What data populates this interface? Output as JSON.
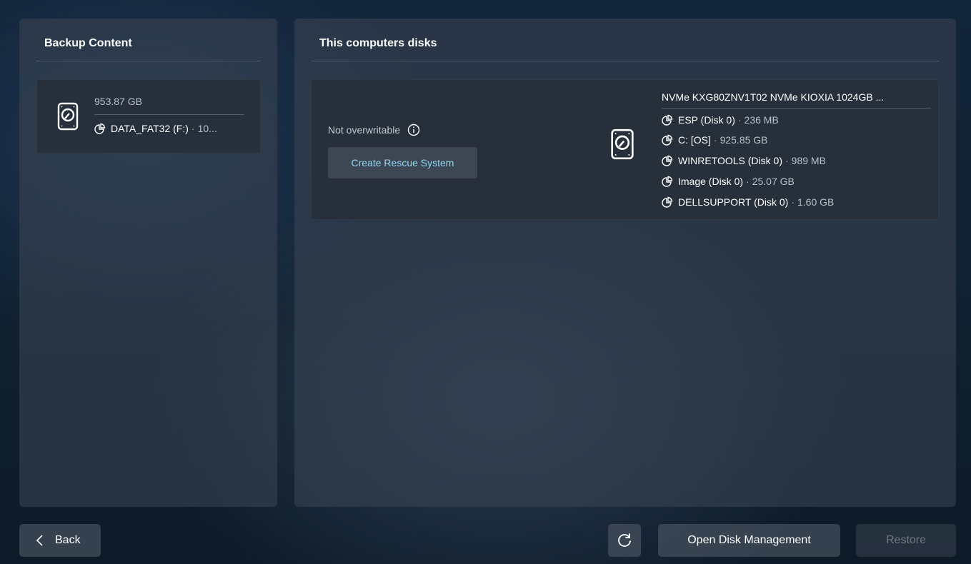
{
  "backup_panel": {
    "title": "Backup Content",
    "item": {
      "size": "953.87 GB",
      "partition_name": "DATA_FAT32 (F:)",
      "partition_size": "10..."
    }
  },
  "disks_panel": {
    "title": "This computers disks",
    "status_text": "Not overwritable",
    "rescue_button_label": "Create Rescue System",
    "disk": {
      "name": "NVMe KXG80ZNV1T02 NVMe KIOXIA 1024GB ...",
      "partitions": [
        {
          "name": "ESP (Disk 0)",
          "size": "236 MB"
        },
        {
          "name": "C: [OS]",
          "size": "925.85 GB"
        },
        {
          "name": "WINRETOOLS (Disk 0)",
          "size": "989 MB"
        },
        {
          "name": "Image (Disk 0)",
          "size": "25.07 GB"
        },
        {
          "name": "DELLSUPPORT (Disk 0)",
          "size": "1.60 GB"
        }
      ]
    }
  },
  "footer": {
    "back_label": "Back",
    "disk_management_label": "Open Disk Management",
    "restore_label": "Restore"
  },
  "separator": "·",
  "icons": {
    "disk": "hard-disk-icon",
    "partition": "pie-chart-icon",
    "info": "info-icon",
    "back": "chevron-left-icon",
    "refresh": "refresh-icon"
  },
  "colors": {
    "accent_link": "#8fd6f2",
    "panel_bg": "#384250",
    "disabled_text": "#6f7782"
  }
}
